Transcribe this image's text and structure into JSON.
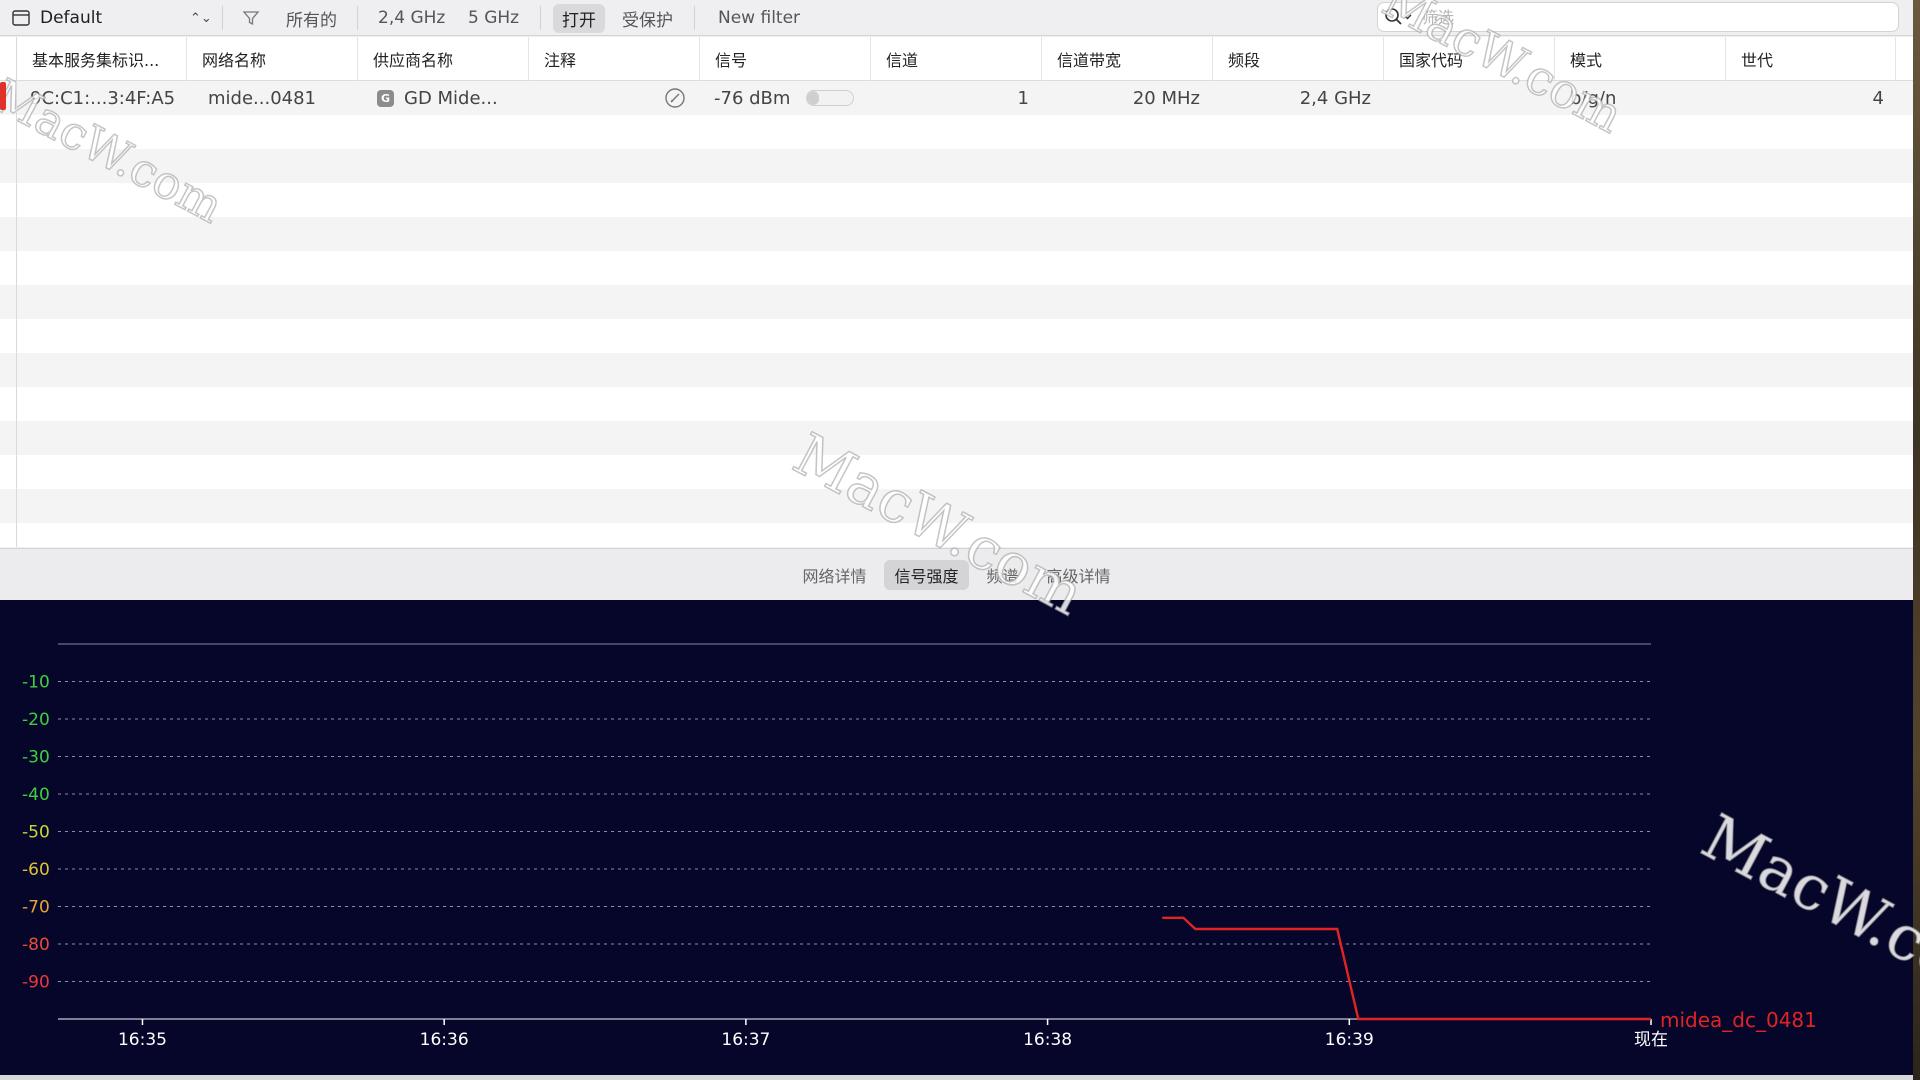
{
  "toolbar": {
    "profile": "Default",
    "filters": {
      "all": "所有的",
      "band_24": "2,4 GHz",
      "band_5": "5 GHz",
      "open": "打开",
      "protected": "受保护",
      "new_filter": "New filter"
    },
    "active_filter": "open",
    "search": {
      "placeholder": "筛选",
      "value": ""
    }
  },
  "table": {
    "columns": [
      "基本服务集标识...",
      "网络名称",
      "供应商名称",
      "注释",
      "信号",
      "信道",
      "信道带宽",
      "频段",
      "国家代码",
      "模式",
      "世代"
    ],
    "rows": [
      {
        "bssid": "9C:C1:...3:4F:A5",
        "network_name": "mide...0481",
        "vendor_badge": "G",
        "vendor": "GD Mide...",
        "note": "",
        "signal": "-76 dBm",
        "signal_level": 0.25,
        "channel": "1",
        "bandwidth": "20 MHz",
        "band": "2,4 GHz",
        "country_code": "",
        "mode": "b/g/n",
        "generation": "4"
      }
    ]
  },
  "tabs": [
    {
      "id": "details",
      "label": "网络详情"
    },
    {
      "id": "signal",
      "label": "信号强度"
    },
    {
      "id": "spectrum",
      "label": "频谱"
    },
    {
      "id": "advanced",
      "label": "高级详情"
    }
  ],
  "active_tab": "signal",
  "chart_data": {
    "type": "line",
    "ylim": [
      -100,
      0
    ],
    "yticks": [
      -10,
      -20,
      -30,
      -40,
      -50,
      -60,
      -70,
      -80,
      -90
    ],
    "ytick_colors": {
      "-10": "#3fcf3f",
      "-20": "#3fcf3f",
      "-30": "#3fcf3f",
      "-40": "#3fcf3f",
      "-50": "#c7d83a",
      "-60": "#e0c23a",
      "-70": "#e8a43a",
      "-80": "#e84a3a",
      "-90": "#e83a3a"
    },
    "x_tick_labels": [
      "16:35",
      "16:36",
      "16:37",
      "16:38",
      "16:39",
      "现在"
    ],
    "x_tick_minutes": [
      0,
      1,
      2,
      3,
      4,
      5
    ],
    "xlim_minutes": [
      -0.28,
      5
    ],
    "series": [
      {
        "name": "midea_dc_0481",
        "color": "#e02424",
        "points": [
          [
            3.38,
            -73
          ],
          [
            3.45,
            -73
          ],
          [
            3.49,
            -76
          ],
          [
            3.96,
            -76
          ],
          [
            4.03,
            -100
          ],
          [
            5.0,
            -100
          ]
        ]
      }
    ],
    "grid": true
  },
  "watermark": {
    "text": "MacW.com"
  }
}
